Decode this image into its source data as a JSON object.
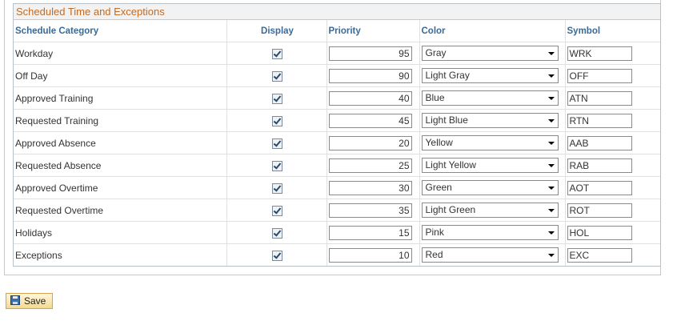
{
  "section_title": "Scheduled Time and Exceptions",
  "columns": {
    "category": "Schedule Category",
    "display": "Display",
    "priority": "Priority",
    "color": "Color",
    "symbol": "Symbol"
  },
  "rows": [
    {
      "category": "Workday",
      "display": true,
      "priority": "95",
      "color": "Gray",
      "symbol": "WRK"
    },
    {
      "category": "Off Day",
      "display": true,
      "priority": "90",
      "color": "Light Gray",
      "symbol": "OFF"
    },
    {
      "category": "Approved Training",
      "display": true,
      "priority": "40",
      "color": "Blue",
      "symbol": "ATN"
    },
    {
      "category": "Requested Training",
      "display": true,
      "priority": "45",
      "color": "Light Blue",
      "symbol": "RTN"
    },
    {
      "category": "Approved Absence",
      "display": true,
      "priority": "20",
      "color": "Yellow",
      "symbol": "AAB"
    },
    {
      "category": "Requested Absence",
      "display": true,
      "priority": "25",
      "color": "Light Yellow",
      "symbol": "RAB"
    },
    {
      "category": "Approved Overtime",
      "display": true,
      "priority": "30",
      "color": "Green",
      "symbol": "AOT"
    },
    {
      "category": "Requested Overtime",
      "display": true,
      "priority": "35",
      "color": "Light Green",
      "symbol": "ROT"
    },
    {
      "category": "Holidays",
      "display": true,
      "priority": "15",
      "color": "Pink",
      "symbol": "HOL"
    },
    {
      "category": "Exceptions",
      "display": true,
      "priority": "10",
      "color": "Red",
      "symbol": "EXC"
    }
  ],
  "save_label": "Save",
  "colors": {
    "title_text": "#c26b25",
    "header_text": "#3a6a95",
    "save_bg": "#f6d88f"
  },
  "icons": {
    "save": "save-disk-icon",
    "dropdown": "chevron-down-icon",
    "checkbox": "checkbox-checked-icon"
  }
}
